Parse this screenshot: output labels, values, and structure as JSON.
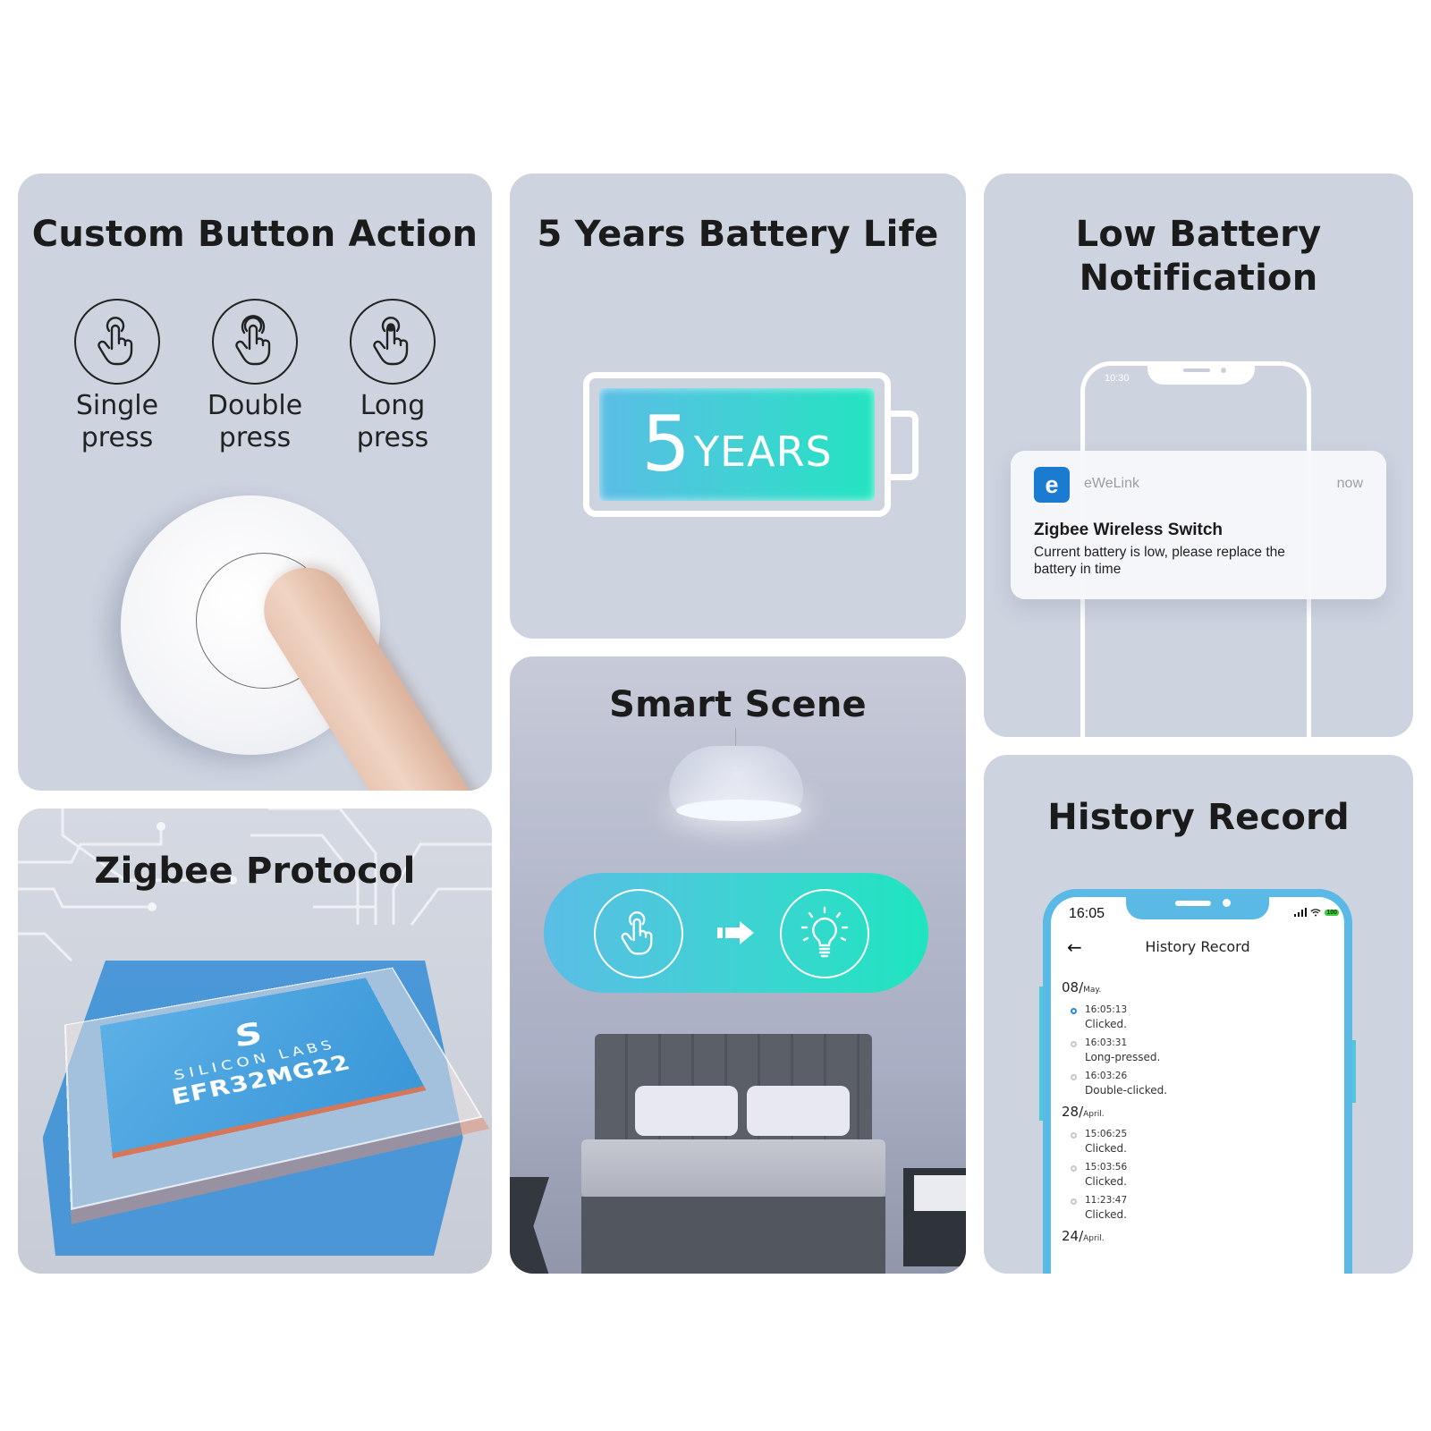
{
  "panels": {
    "custom_button": {
      "title": "Custom Button Action",
      "actions": [
        {
          "icon": "single-tap-icon",
          "line1": "Single",
          "line2": "press"
        },
        {
          "icon": "double-tap-icon",
          "line1": "Double",
          "line2": "press"
        },
        {
          "icon": "long-press-icon",
          "line1": "Long",
          "line2": "press"
        }
      ]
    },
    "battery_life": {
      "title": "5 Years Battery Life",
      "number": "5",
      "unit": "YEARS"
    },
    "low_battery": {
      "title_line1": "Low Battery",
      "title_line2": "Notification",
      "phone_time": "10:30",
      "notification": {
        "app_icon_letter": "e",
        "app_name": "eWeLink",
        "time": "now",
        "title": "Zigbee Wireless Switch",
        "body": "Current battery is low, please replace the battery in time"
      }
    },
    "zigbee": {
      "title": "Zigbee Protocol",
      "chip_logo": "S",
      "chip_brand": "SILICON LABS",
      "chip_model": "EFR32MG22"
    },
    "smart_scene": {
      "title": "Smart Scene",
      "trigger_icon": "tap-icon",
      "result_icon": "light-bulb-icon"
    },
    "history": {
      "title": "History Record",
      "phone": {
        "time": "16:05",
        "battery": "100",
        "screen_title": "History Record",
        "groups": [
          {
            "day": "08/",
            "month": "May.",
            "entries": [
              {
                "time": "16:05:13",
                "action": "Clicked.",
                "active": true
              },
              {
                "time": "16:03:31",
                "action": "Long-pressed.",
                "active": false
              },
              {
                "time": "16:03:26",
                "action": "Double-clicked.",
                "active": false
              }
            ]
          },
          {
            "day": "28/",
            "month": "April.",
            "entries": [
              {
                "time": "15:06:25",
                "action": "Clicked.",
                "active": false
              },
              {
                "time": "15:03:56",
                "action": "Clicked.",
                "active": false
              },
              {
                "time": "11:23:47",
                "action": "Clicked.",
                "active": false
              }
            ]
          },
          {
            "day": "24/",
            "month": "April.",
            "entries": []
          }
        ]
      }
    }
  },
  "colors": {
    "panel_bg": "#cdd3df",
    "gradient_start": "#5bbde6",
    "gradient_end": "#1fe5bf",
    "ewelink_blue": "#1a7bd0",
    "phone_frame_blue": "#5bb9e6",
    "active_dot": "#2a86d8"
  }
}
